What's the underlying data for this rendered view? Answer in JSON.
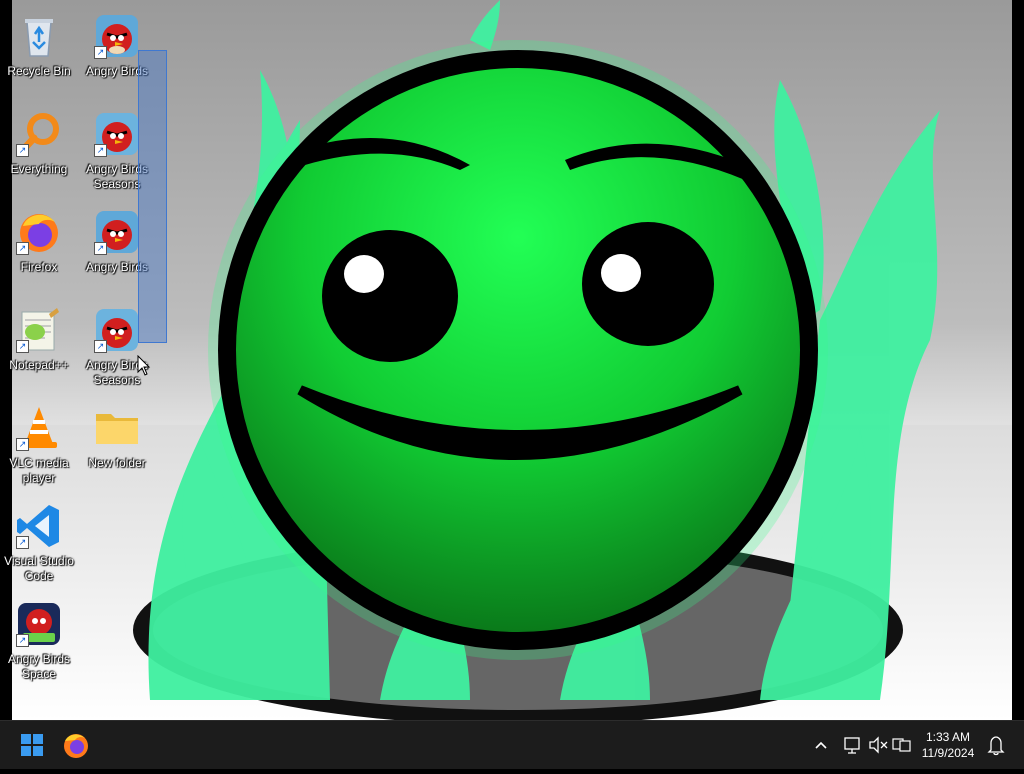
{
  "desktop": {
    "icons": [
      {
        "label": "Recycle Bin",
        "icon": "recycle-bin-icon",
        "shortcut": false
      },
      {
        "label": "Angry Birds",
        "icon": "angry-birds-icon",
        "shortcut": true
      },
      {
        "label": "Everything",
        "icon": "everything-search-icon",
        "shortcut": true
      },
      {
        "label": "Angry Birds Seasons",
        "icon": "angry-birds-icon",
        "shortcut": true
      },
      {
        "label": "Firefox",
        "icon": "firefox-icon",
        "shortcut": true
      },
      {
        "label": "Angry Birds",
        "icon": "angry-birds-icon",
        "shortcut": true
      },
      {
        "label": "Notepad++",
        "icon": "notepad-plus-plus-icon",
        "shortcut": true
      },
      {
        "label": "Angry Birds Seasons",
        "icon": "angry-birds-icon",
        "shortcut": true
      },
      {
        "label": "VLC media player",
        "icon": "vlc-icon",
        "shortcut": true
      },
      {
        "label": "New folder",
        "icon": "folder-icon",
        "shortcut": false
      },
      {
        "label": "Visual Studio Code",
        "icon": "vscode-icon",
        "shortcut": true
      },
      {
        "label": "Angry Birds Space",
        "icon": "angry-birds-space-icon",
        "shortcut": true
      }
    ]
  },
  "taskbar": {
    "start_icon": "windows-start-icon",
    "pinned": [
      {
        "name": "Firefox",
        "icon": "firefox-icon"
      }
    ],
    "tray": {
      "chevron_icon": "chevron-up-icon",
      "network_icon": "network-icon",
      "volume_icon": "volume-muted-icon",
      "language_icon": "input-language-icon",
      "notification_icon": "notification-bell-icon"
    },
    "clock": {
      "time": "1:33 AM",
      "date": "11/9/2024"
    }
  },
  "colors": {
    "taskbar_bg": "#1c1c1c",
    "wallpaper_green": "#22dd44",
    "flame_green": "#33ee99",
    "selection": "#3f78d0"
  }
}
